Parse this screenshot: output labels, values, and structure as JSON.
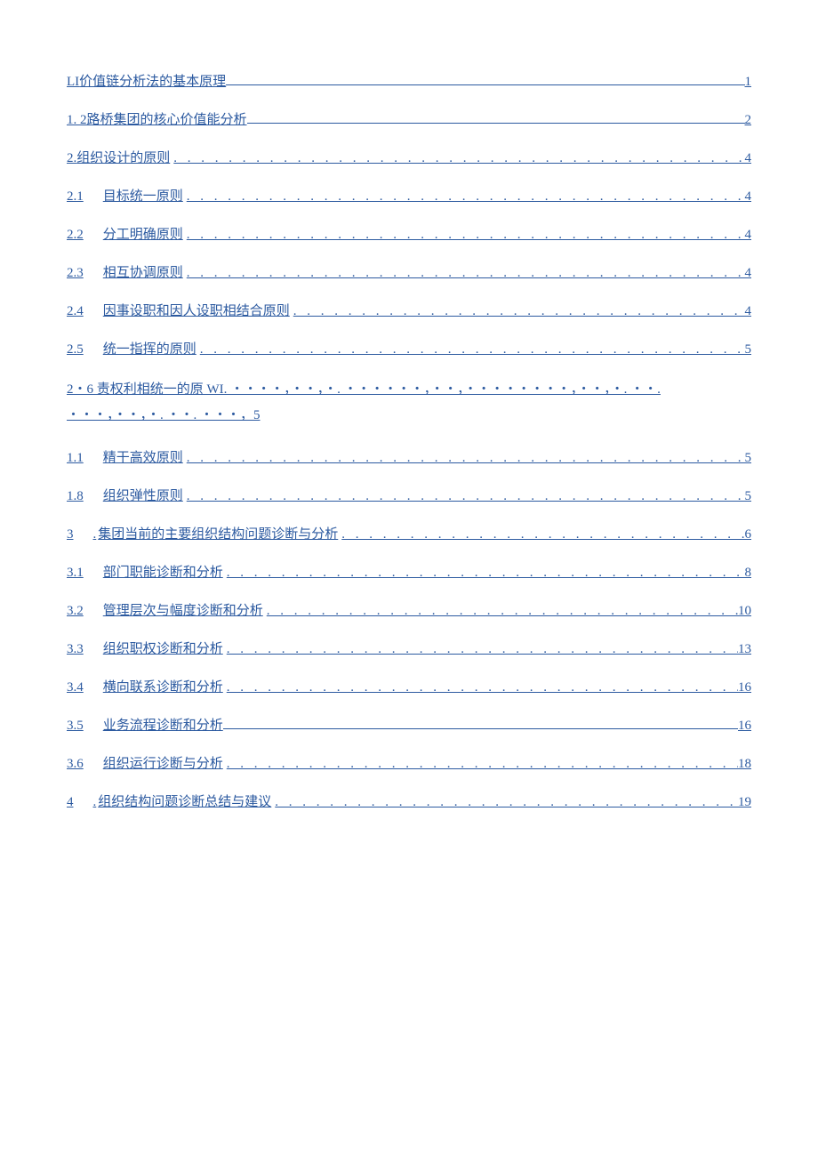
{
  "toc": [
    {
      "num": "LI",
      "title": "价值链分析法的基本原理",
      "page": "1",
      "style": "solid",
      "indented": false,
      "prefixDot": false
    },
    {
      "num": "1. 2",
      "title": "路桥集团的核心价值能分析",
      "page": "2",
      "style": "solid",
      "indented": false,
      "prefixDot": false
    },
    {
      "num": "2.",
      "title": "组织设计的原则",
      "page": "4",
      "style": "dots",
      "indented": false,
      "prefixDot": false
    },
    {
      "num": "2.1",
      "title": "目标统一原则",
      "page": "4",
      "style": "dots",
      "indented": true,
      "prefixDot": false
    },
    {
      "num": "2.2",
      "title": "分工明确原则",
      "page": "4",
      "style": "dots",
      "indented": true,
      "prefixDot": false
    },
    {
      "num": "2.3",
      "title": "相互协调原则",
      "page": "4",
      "style": "dots",
      "indented": true,
      "prefixDot": false
    },
    {
      "num": "2.4",
      "title": "因事设职和因人设职相结合原则",
      "page": "4",
      "style": "dots",
      "indented": true,
      "prefixDot": false
    },
    {
      "num": "2.5",
      "title": "统一指挥的原则",
      "page": "5",
      "style": "dots",
      "indented": true,
      "prefixDot": false
    },
    {
      "multiline": true,
      "text": "2・6 责权利相统一的原 WI. ・・・・，・・，・. ・・・・・・，・・，・・・・・・・・，・・，・. ・・. ・・・，・・，・. ・・. ・・・，5"
    },
    {
      "num": "1.1",
      "title": "精干高效原则",
      "page": "5",
      "style": "dots",
      "indented": true,
      "prefixDot": false
    },
    {
      "num": "1.8",
      "title": "组织弹性原则",
      "page": "5",
      "style": "dots",
      "indented": true,
      "prefixDot": false
    },
    {
      "num": "3",
      "title": "集团当前的主要组织结构问题诊断与分析",
      "page": "6",
      "style": "dots",
      "indented": true,
      "prefixDot": true
    },
    {
      "num": "3.1",
      "title": "部门职能诊断和分析",
      "page": "8",
      "style": "dots",
      "indented": true,
      "prefixDot": false
    },
    {
      "num": "3.2",
      "title": "管理层次与幅度诊断和分析",
      "page": "10",
      "style": "dots",
      "indented": true,
      "prefixDot": false
    },
    {
      "num": "3.3",
      "title": "组织职权诊断和分析",
      "page": "13",
      "style": "dots",
      "indented": true,
      "prefixDot": false
    },
    {
      "num": "3.4",
      "title": "横向联系诊断和分析",
      "page": "16",
      "style": "dots",
      "indented": true,
      "prefixDot": false
    },
    {
      "num": "3.5",
      "title": "业务流程诊断和分析",
      "page": "16",
      "style": "solid",
      "indented": true,
      "prefixDot": false
    },
    {
      "num": "3.6",
      "title": "组织运行诊断与分析",
      "page": "18",
      "style": "dots",
      "indented": true,
      "prefixDot": false
    },
    {
      "num": "4",
      "title": "组织结构问题诊断总结与建议",
      "page": "19",
      "style": "dots",
      "indented": true,
      "prefixDot": true
    }
  ],
  "leaderDots": ". . . . . . . . . . . . . . . . . . . . . . . . . . . . . . . . . . . . . . . . . . . . . . . . . . . . . . . . . . . . . . . . . . . . . . . . . . . . . . . ."
}
